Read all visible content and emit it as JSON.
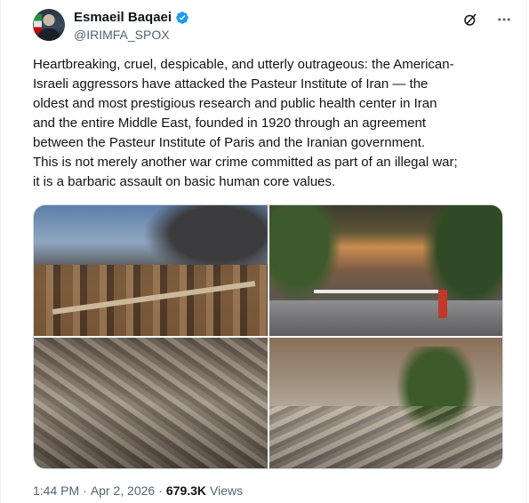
{
  "author": {
    "display_name": "Esmaeil Baqaei",
    "handle": "@IRIMFA_SPOX",
    "verified_icon": "verified-badge-icon",
    "verified_color": "#1d9bf0"
  },
  "header_actions": {
    "grok_icon": "grok-icon",
    "more_icon": "more-icon"
  },
  "tweet": {
    "text": "Heartbreaking, cruel, despicable, and utterly outrageous: the American-\nIsraeli aggressors have attacked the Pasteur Institute of Iran — the\noldest and most prestigious research and public health center in Iran\nand the entire Middle East, founded in 1920 through an agreement\nbetween the Pasteur Institute of Paris and the Iranian government.\nThis is not merely another war crime committed as part of an illegal war;\nit is a barbaric assault on basic human core values."
  },
  "meta": {
    "time": "1:44 PM",
    "sep1": "·",
    "date": "Apr 2, 2026",
    "sep2": "·",
    "views_count": "679.3K",
    "views_label": "Views"
  },
  "colors": {
    "text_primary": "#0f1419",
    "text_secondary": "#536471",
    "border": "#cfd9de"
  }
}
